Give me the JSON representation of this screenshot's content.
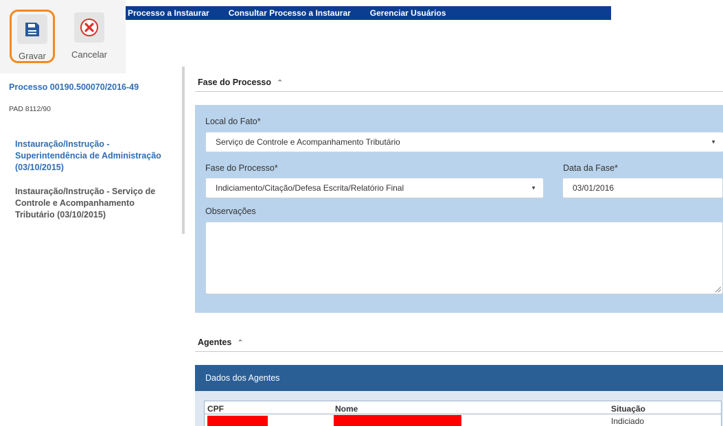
{
  "topnav": {
    "items": [
      "Processo a Instaurar",
      "Consultar Processo a Instaurar",
      "Gerenciar Usuários"
    ]
  },
  "toolbar": {
    "save_label": "Gravar",
    "cancel_label": "Cancelar",
    "save_icon": "floppy-disk-icon",
    "cancel_icon": "x-circle-icon"
  },
  "sidebar": {
    "process_title": "Processo 00190.500070/2016-49",
    "subtitle": "PAD 8112/90",
    "items": [
      {
        "label": "Instauração/Instrução - Superintendência de Administração (03/10/2015)",
        "active": true
      },
      {
        "label": "Instauração/Instrução - Serviço de Controle e Acompanhamento Tributário (03/10/2015)",
        "active": false
      }
    ]
  },
  "fase": {
    "heading": "Fase do Processo",
    "local_label": "Local do Fato*",
    "local_value": "Serviço de Controle e Acompanhamento Tributário",
    "fase_label": "Fase do Processo*",
    "fase_value": "Indiciamento/Citação/Defesa Escrita/Relatório Final",
    "data_label": "Data da Fase*",
    "data_value": "03/01/2016",
    "obs_label": "Observações",
    "obs_value": ""
  },
  "agentes": {
    "heading": "Agentes",
    "panel_title": "Dados dos Agentes",
    "columns": [
      "CPF",
      "Nome",
      "Situação"
    ],
    "rows": [
      {
        "situacao": "Indiciado"
      }
    ]
  },
  "colors": {
    "nav_bg": "#0b3d91",
    "panel_bg": "#b9d3ec",
    "agents_header_bg": "#2a5f96",
    "link": "#2f6db5",
    "highlight": "#f08a24",
    "redaction": "#ff0000"
  }
}
